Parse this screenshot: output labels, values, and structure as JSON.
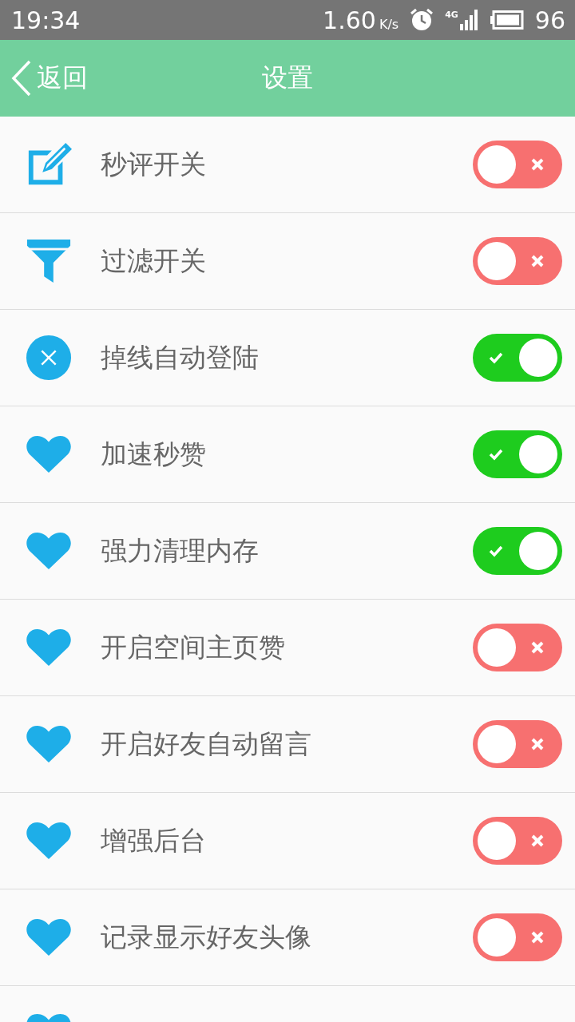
{
  "status_bar": {
    "time": "19:34",
    "speed": "1.60",
    "speed_unit": "K/s",
    "network": "4G",
    "battery": "96"
  },
  "header": {
    "back": "返回",
    "title": "设置"
  },
  "settings": [
    {
      "kind": "edit",
      "label": "秒评开关",
      "on": false
    },
    {
      "kind": "filter",
      "label": "过滤开关",
      "on": false
    },
    {
      "kind": "close",
      "label": "掉线自动登陆",
      "on": true
    },
    {
      "kind": "heart",
      "label": "加速秒赞",
      "on": true
    },
    {
      "kind": "heart",
      "label": "强力清理内存",
      "on": true
    },
    {
      "kind": "heart",
      "label": "开启空间主页赞",
      "on": false
    },
    {
      "kind": "heart",
      "label": "开启好友自动留言",
      "on": false
    },
    {
      "kind": "heart",
      "label": "增强后台",
      "on": false
    },
    {
      "kind": "heart",
      "label": "记录显示好友头像",
      "on": false
    }
  ],
  "partial_row": {
    "kind": "heart"
  }
}
